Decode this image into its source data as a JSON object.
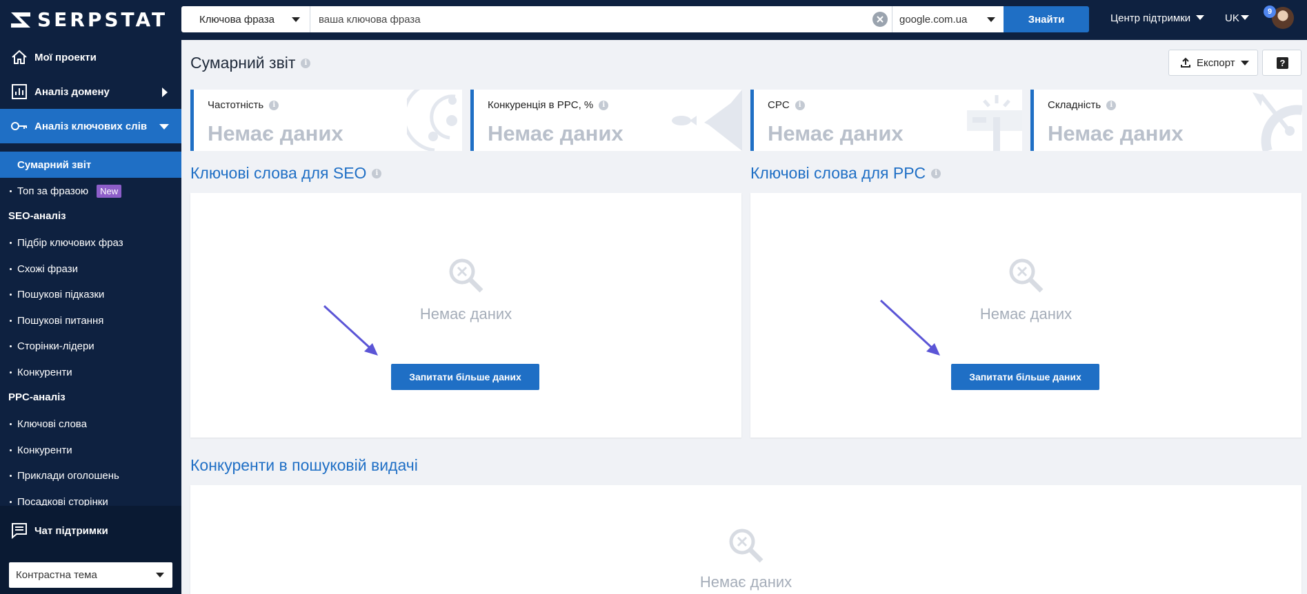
{
  "app": {
    "logo_text": "SERPSTAT"
  },
  "header": {
    "search_type": "Ключова фраза",
    "search_placeholder": "ваша ключова фраза",
    "search_engine": "google.com.ua",
    "find_label": "Знайти",
    "support_label": "Центр підтримки",
    "lang_label": "UK",
    "notifications_count": "9"
  },
  "sidebar": {
    "my_projects": "Мої проекти",
    "domain_analysis": "Аналіз домену",
    "keyword_analysis": "Аналіз ключових слів",
    "summary": "Сумарний звіт",
    "top_by_phrase": "Топ за фразою",
    "new_badge": "New",
    "seo_head": "SEO-аналіз",
    "seo_items": [
      "Підбір ключових фраз",
      "Схожі фрази",
      "Пошукові підказки",
      "Пошукові питання",
      "Сторінки-лідери",
      "Конкуренти"
    ],
    "ppc_head": "PPC-аналіз",
    "ppc_items": [
      "Ключові слова",
      "Конкуренти",
      "Приклади оголошень",
      "Посадкові сторінки"
    ],
    "chat": "Чат підтримки",
    "theme": "Контрастна тема"
  },
  "main": {
    "title": "Сумарний звіт",
    "export_label": "Експорт",
    "help_label": "?",
    "metrics": [
      {
        "label": "Частотність",
        "value": "Немає даних"
      },
      {
        "label": "Конкуренція в PPC, %",
        "value": "Немає даних"
      },
      {
        "label": "CPC",
        "value": "Немає даних"
      },
      {
        "label": "Складність",
        "value": "Немає даних"
      }
    ],
    "seo_title": "Ключові слова для SEO",
    "ppc_title": "Ключові слова для PPC",
    "competitors_title": "Конкуренти в пошуковій видачі",
    "no_data": "Немає даних",
    "request_more": "Запитати більше даних"
  },
  "colors": {
    "accent": "#1f6fc5",
    "navy": "#0e2140",
    "badge": "#8d5ec9",
    "arrow": "#5b55d6"
  }
}
